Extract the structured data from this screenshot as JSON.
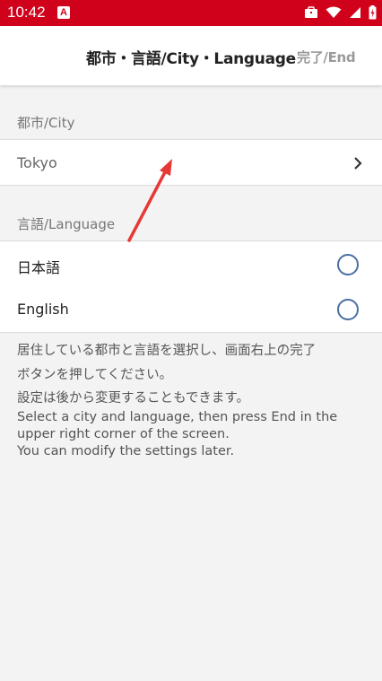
{
  "status": {
    "time": "10:42",
    "notification_icon": "A"
  },
  "header": {
    "title": "都市・言語/City・Language",
    "end_label": "完了/End"
  },
  "city_section": {
    "header": "都市/City",
    "selected_city": "Tokyo"
  },
  "language_section": {
    "header": "言語/Language",
    "options": [
      {
        "label": "日本語",
        "selected": false
      },
      {
        "label": "English",
        "selected": false
      }
    ]
  },
  "help": {
    "jp_line1": "居住している都市と言語を選択し、画面右上の完了",
    "jp_line2": "ボタンを押してください。",
    "jp_line3": "設定は後から変更することもできます。",
    "en_line1": "Select a city and language, then press End in the",
    "en_line2": "upper right corner of the screen.",
    "en_line3": "You can modify the settings later."
  },
  "colors": {
    "status_bar": "#d0021b",
    "annotation_arrow": "#e53935",
    "radio": "#4a6fa5"
  }
}
